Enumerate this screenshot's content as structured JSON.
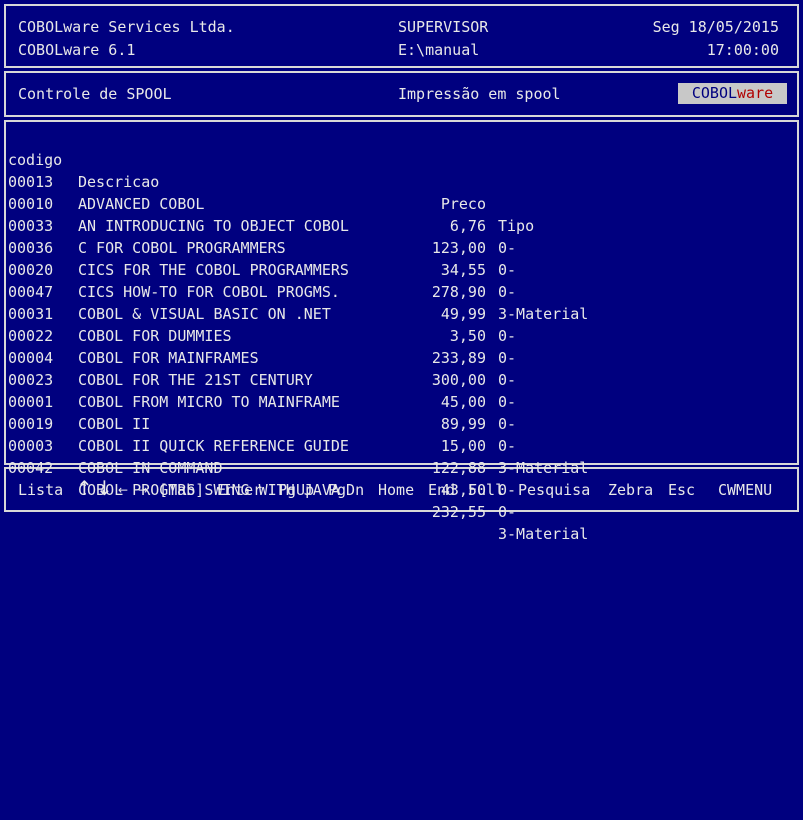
{
  "header": {
    "company": "COBOLware Services Ltda.",
    "product": "COBOLware 6.1",
    "user": "SUPERVISOR",
    "path": "E:\\manual",
    "date": "Seg 18/05/2015",
    "time": "17:00:00"
  },
  "subheader": {
    "title": "Controle de SPOOL",
    "subtitle": "Impressão em spool",
    "logo_part1": "COBOL",
    "logo_part2": "ware"
  },
  "table": {
    "columns": [
      "codigo",
      "Descricao",
      "Preco",
      "Tipo"
    ],
    "rows": [
      {
        "codigo": "00013",
        "descricao": "ADVANCED COBOL",
        "preco": "6,76",
        "tipo": "0-"
      },
      {
        "codigo": "00010",
        "descricao": "AN INTRODUCING TO OBJECT COBOL",
        "preco": "123,00",
        "tipo": "0-"
      },
      {
        "codigo": "00033",
        "descricao": "C FOR COBOL PROGRAMMERS",
        "preco": "34,55",
        "tipo": "0-"
      },
      {
        "codigo": "00036",
        "descricao": "CICS FOR THE COBOL PROGRAMMERS",
        "preco": "278,90",
        "tipo": "3-Material"
      },
      {
        "codigo": "00020",
        "descricao": "CICS HOW-TO FOR COBOL PROGMS.",
        "preco": "49,99",
        "tipo": "0-"
      },
      {
        "codigo": "00047",
        "descricao": "COBOL & VISUAL BASIC ON .NET",
        "preco": "3,50",
        "tipo": "0-"
      },
      {
        "codigo": "00031",
        "descricao": "COBOL FOR DUMMIES",
        "preco": "233,89",
        "tipo": "0-"
      },
      {
        "codigo": "00022",
        "descricao": "COBOL FOR MAINFRAMES",
        "preco": "300,00",
        "tipo": "0-"
      },
      {
        "codigo": "00004",
        "descricao": "COBOL FOR THE 21ST CENTURY",
        "preco": "45,00",
        "tipo": "0-"
      },
      {
        "codigo": "00023",
        "descricao": "COBOL FROM MICRO TO MAINFRAME",
        "preco": "89,99",
        "tipo": "0-"
      },
      {
        "codigo": "00001",
        "descricao": "COBOL II",
        "preco": "15,00",
        "tipo": "3-Material"
      },
      {
        "codigo": "00019",
        "descricao": "COBOL II QUICK REFERENCE GUIDE",
        "preco": "122,88",
        "tipo": "0-"
      },
      {
        "codigo": "00003",
        "descricao": "COBOL IN COMMAND",
        "preco": "43,50",
        "tipo": "0-"
      },
      {
        "codigo": "00042",
        "descricao": "COBOL PROGMRS SWING WITH JAVA",
        "preco": "232,55",
        "tipo": "3-Material"
      }
    ]
  },
  "footer": {
    "lista": "Lista",
    "up_arrow": "↑",
    "down_arrow": "↓",
    "left_arrow": "←",
    "right_arrow": "→",
    "tab": "[Tab]",
    "enter": "Enter",
    "pgup": "PgUp",
    "pgdn": "PgDn",
    "home": "Home",
    "end": "End",
    "full": "Full",
    "pesquisa": "Pesquisa",
    "zebra": "Zebra",
    "esc": "Esc",
    "cwmenu": "CWMENU"
  }
}
